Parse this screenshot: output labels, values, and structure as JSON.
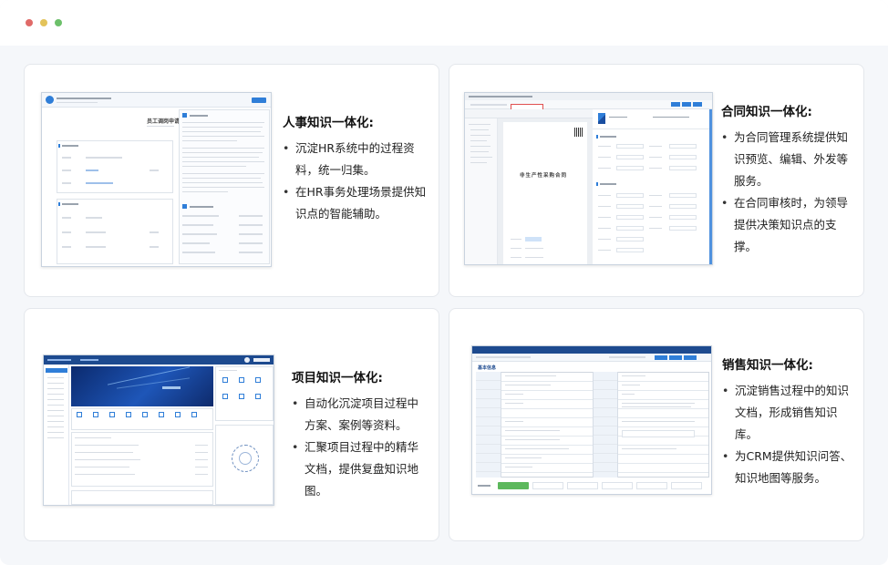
{
  "window": {
    "controls": [
      "close",
      "minimize",
      "maximize"
    ]
  },
  "cards": [
    {
      "title": "人事知识一体化:",
      "bullets": [
        "沉淀HR系统中的过程资料，统一归集。",
        "在HR事务处理场景提供知识点的智能辅助。"
      ],
      "screenshot": {
        "heading": "员工调岗申请"
      }
    },
    {
      "title": "合同知识一体化:",
      "bullets": [
        "为合同管理系统提供知识预览、编辑、外发等服务。",
        "在合同审核时，为领导提供决策知识点的支撑。"
      ],
      "screenshot": {
        "heading": "非生产性采购合同"
      }
    },
    {
      "title": "项目知识一体化:",
      "bullets": [
        "自动化沉淀项目过程中方案、案例等资料。",
        "汇聚项目过程中的精华文档，提供复盘知识地图。"
      ],
      "screenshot": {}
    },
    {
      "title": "销售知识一体化:",
      "bullets": [
        "沉淀销售过程中的知识文档，形成销售知识库。",
        "为CRM提供知识问答、知识地图等服务。"
      ],
      "screenshot": {
        "heading": "基本信息"
      }
    }
  ],
  "colors": {
    "accent": "#2f7ed8",
    "dark_navy": "#0e2a6b",
    "card_border": "#e4e7ec",
    "background": "#f5f7fa"
  }
}
